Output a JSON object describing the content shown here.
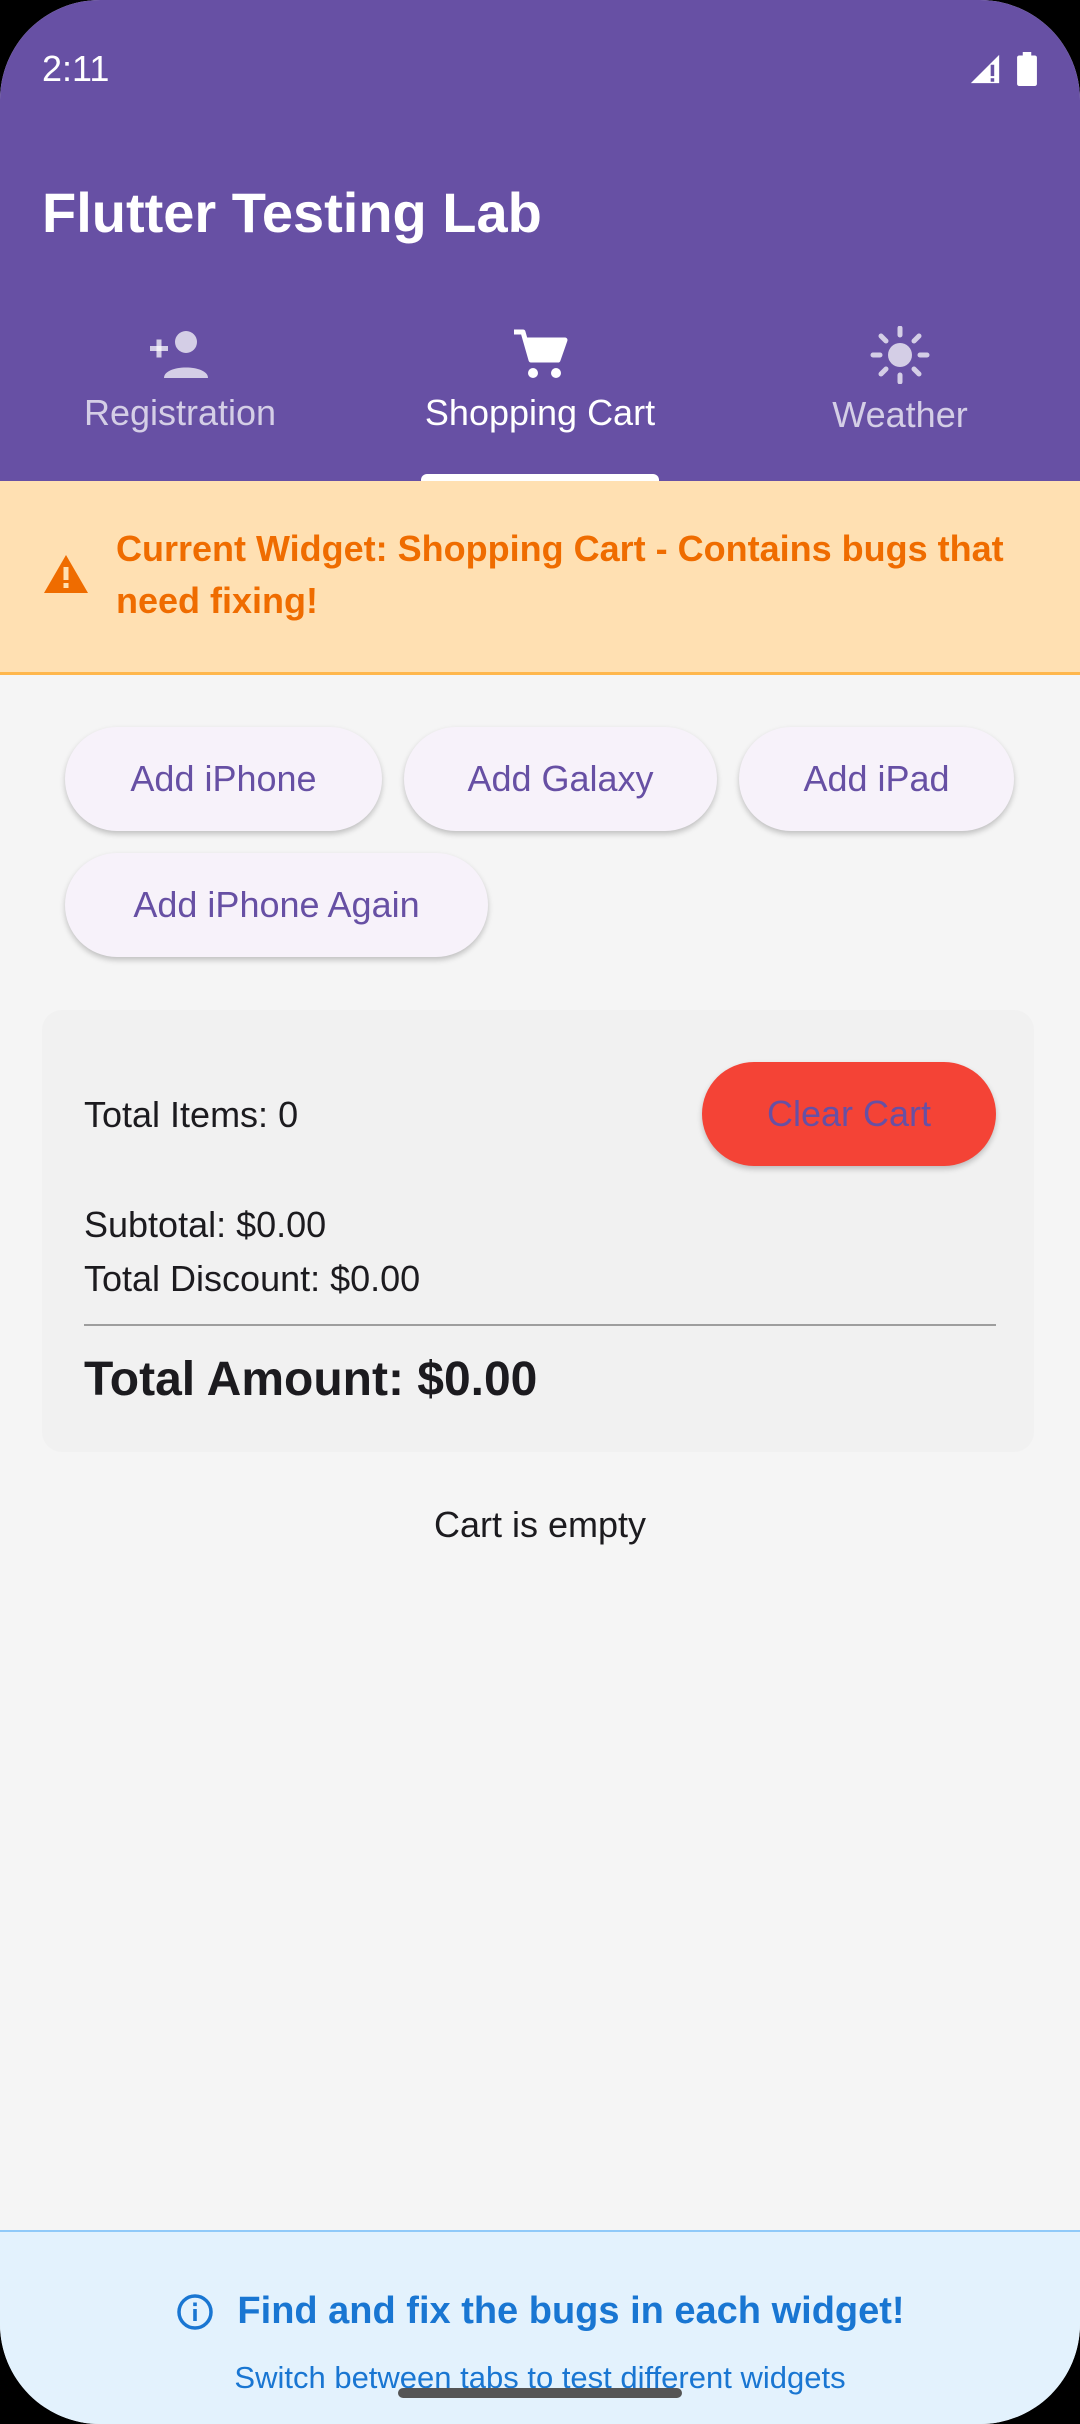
{
  "status_bar": {
    "time": "2:11"
  },
  "app_bar": {
    "title": "Flutter Testing Lab"
  },
  "tabs": [
    {
      "label": "Registration",
      "icon": "person-add-icon",
      "active": false
    },
    {
      "label": "Shopping Cart",
      "icon": "shopping-cart-icon",
      "active": true
    },
    {
      "label": "Weather",
      "icon": "sun-icon",
      "active": false
    }
  ],
  "banner": {
    "icon": "warning-icon",
    "text": "Current Widget: Shopping Cart - Contains bugs that need fixing!"
  },
  "actions": {
    "add_iphone": "Add iPhone",
    "add_galaxy": "Add Galaxy",
    "add_ipad": "Add iPad",
    "add_iphone_again": "Add iPhone Again"
  },
  "summary": {
    "total_items": "Total Items: 0",
    "clear_cart": "Clear Cart",
    "subtotal": "Subtotal: $0.00",
    "total_discount": "Total Discount: $0.00",
    "total_amount": "Total Amount: $0.00"
  },
  "cart": {
    "empty_text": "Cart is empty"
  },
  "footer": {
    "icon": "info-icon",
    "title": "Find and fix the bugs in each widget!",
    "subtitle": "Switch between tabs to test different widgets"
  },
  "colors": {
    "primary": "#6750a4",
    "warning_bg": "#ffe0b2",
    "warning_text": "#ef6c00",
    "danger": "#f44336",
    "info_bg": "#e3f2fd",
    "info_text": "#1976d2"
  }
}
